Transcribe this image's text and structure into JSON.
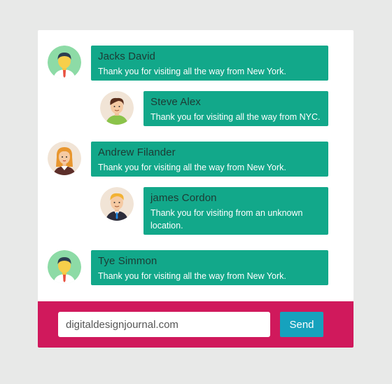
{
  "messages": [
    {
      "name": "Jacks David",
      "text": "Thank you for visiting all the way from New York.",
      "avatar": "male-avatar-icon"
    },
    {
      "name": "Steve Alex",
      "text": "Thank you for visiting all the way from NYC.",
      "avatar": "male-avatar-icon"
    },
    {
      "name": "Andrew Filander",
      "text": "Thank you for visiting all the way from New York.",
      "avatar": "female-avatar-icon"
    },
    {
      "name": "james Cordon",
      "text": "Thank you for visiting from an unknown location.",
      "avatar": "male-avatar-icon"
    },
    {
      "name": "Tye Simmon",
      "text": "Thank you for visiting all the way from New York.",
      "avatar": "male-avatar-icon"
    }
  ],
  "composer": {
    "input_value": "digitaldesignjournal.com",
    "send_label": "Send"
  },
  "colors": {
    "background": "#e8e9e8",
    "bubble": "#12a88a",
    "composer": "#d0195c",
    "send_button": "#16a2bd"
  }
}
